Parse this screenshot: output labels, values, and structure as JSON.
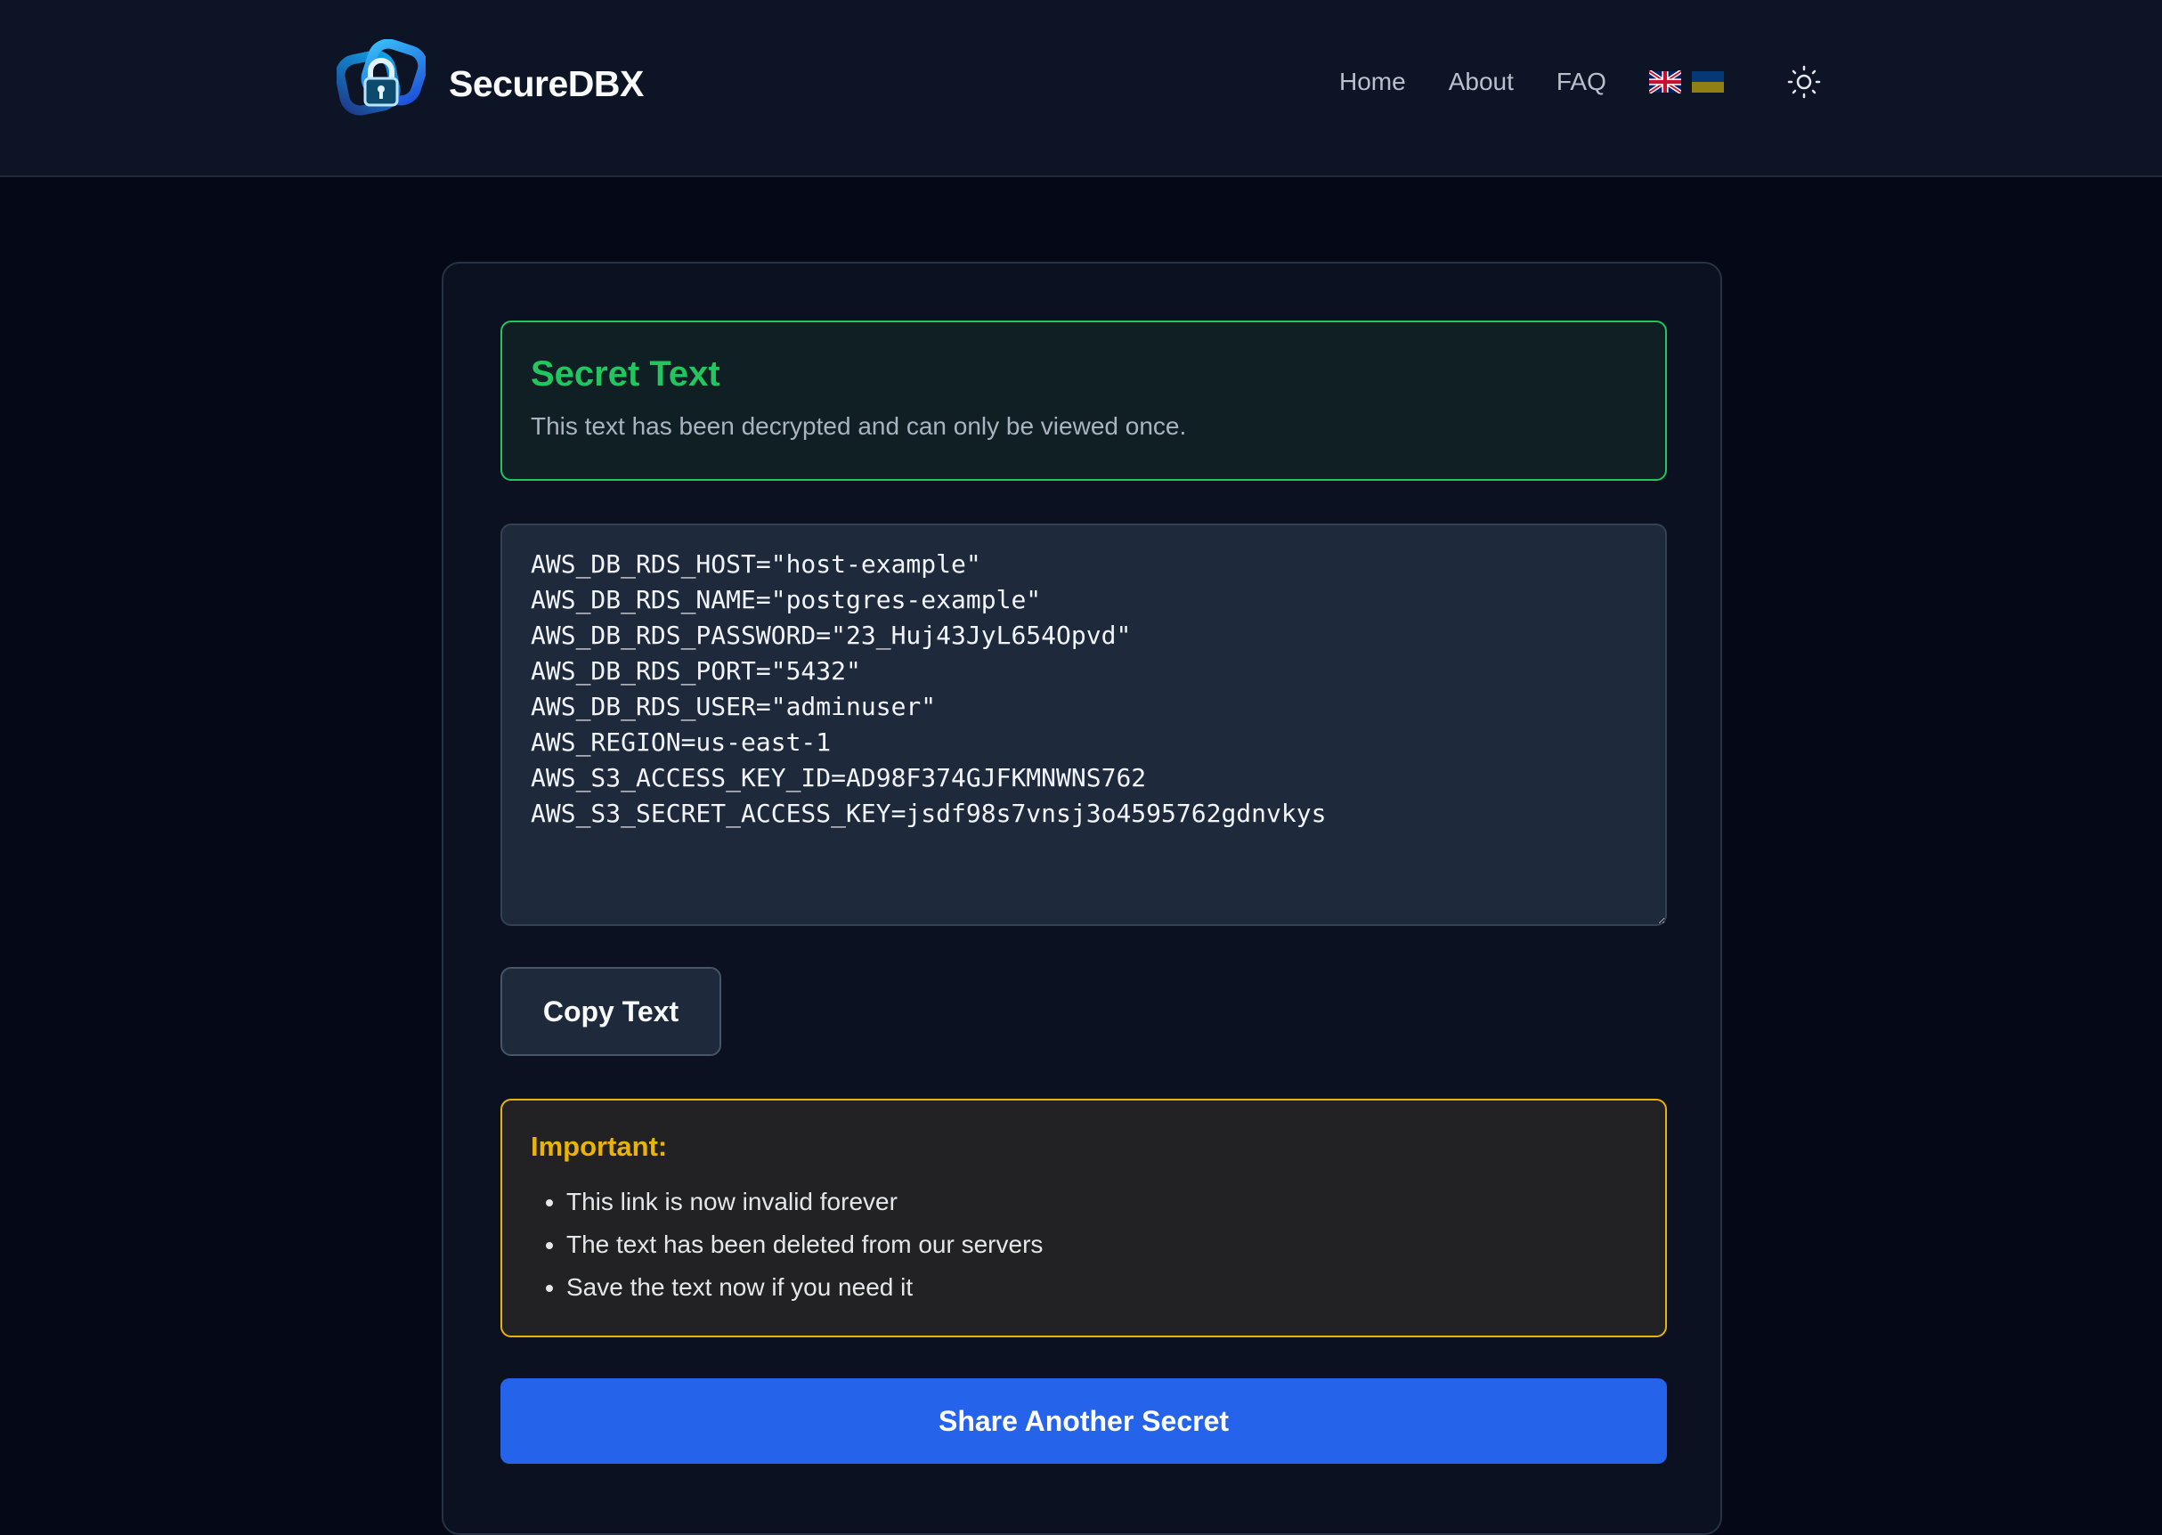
{
  "app": {
    "name": "SecureDBX"
  },
  "nav": {
    "items": [
      "Home",
      "About",
      "FAQ"
    ],
    "languages": [
      "English",
      "Ukrainian"
    ],
    "theme_icon": "sun-icon"
  },
  "success": {
    "title": "Secret Text",
    "description": "This text has been decrypted and can only be viewed once."
  },
  "secret": {
    "value": "AWS_DB_RDS_HOST=\"host-example\"\nAWS_DB_RDS_NAME=\"postgres-example\"\nAWS_DB_RDS_PASSWORD=\"23_Huj43JyL654Opvd\"\nAWS_DB_RDS_PORT=\"5432\"\nAWS_DB_RDS_USER=\"adminuser\"\nAWS_REGION=us-east-1\nAWS_S3_ACCESS_KEY_ID=AD98F374GJFKMNWNS762\nAWS_S3_SECRET_ACCESS_KEY=jsdf98s7vnsj3o4595762gdnvkys"
  },
  "actions": {
    "copy_label": "Copy Text",
    "share_label": "Share Another Secret"
  },
  "warning": {
    "title": "Important:",
    "items": [
      "This link is now invalid forever",
      "The text has been deleted from our servers",
      "Save the text now if you need it"
    ]
  },
  "colors": {
    "accent": "#2563eb",
    "success": "#22c55e",
    "warning": "#eab308",
    "background": "#050816"
  }
}
